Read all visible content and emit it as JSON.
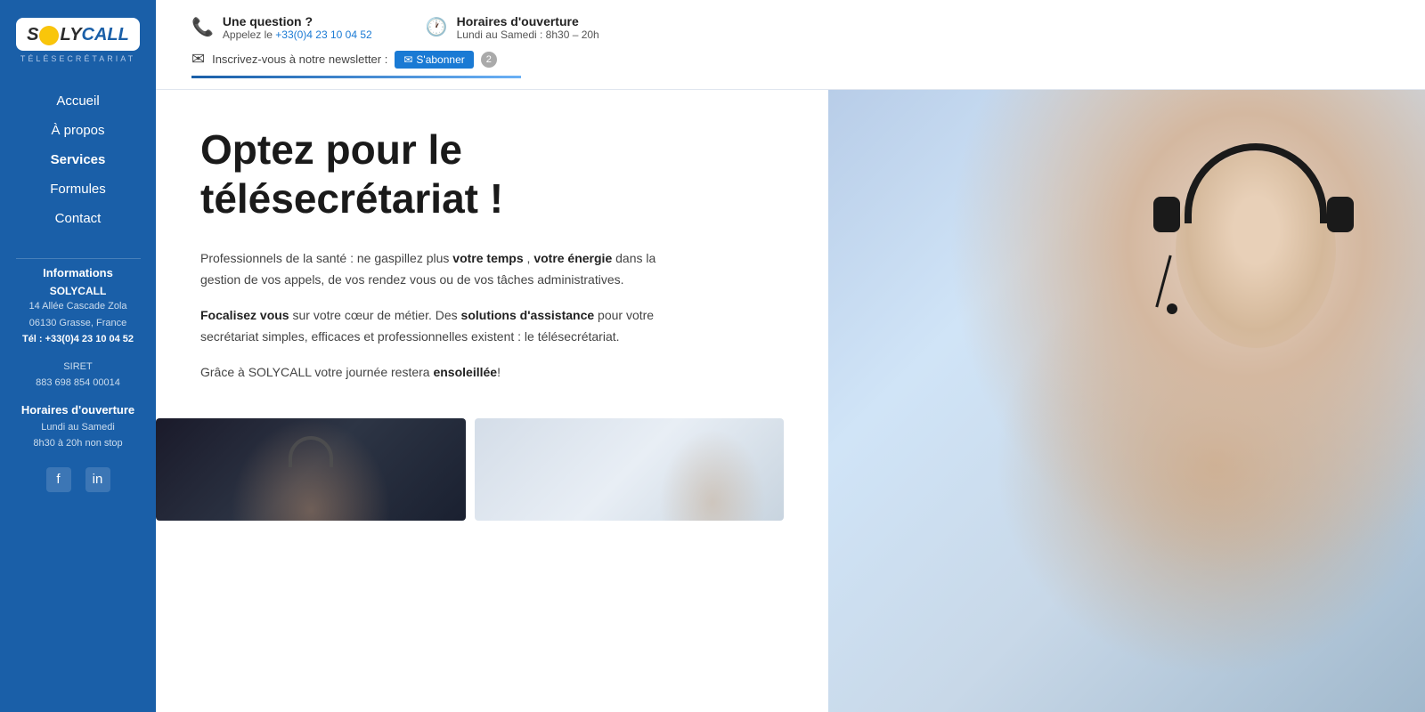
{
  "sidebar": {
    "logo_sol": "S",
    "logo_call": "LYCALL",
    "logo_subtitle": "TÉLÉSECRÉTARIAT",
    "nav": {
      "accueil": "Accueil",
      "apropos": "À propos",
      "services": "Services",
      "formules": "Formules",
      "contact": "Contact"
    },
    "info_title": "Informations",
    "company_name": "SOLYCALL",
    "address_line1": "14 Allée Cascade Zola",
    "address_line2": "06130 Grasse, France",
    "tel_label": "Tél : +33(0)4 23 10 04 52",
    "siret_label": "SIRET",
    "siret_number": "883 698 854 00014",
    "hours_title": "Horaires d'ouverture",
    "hours_line1": "Lundi au Samedi",
    "hours_line2": "8h30 à 20h non stop",
    "social_facebook": "f",
    "social_linkedin": "in"
  },
  "topbar": {
    "question_label": "Une question ?",
    "question_sub_prefix": "Appelez le ",
    "phone_number": "+33(0)4 23 10 04 52",
    "hours_label": "Horaires d'ouverture",
    "hours_sub": "Lundi au Samedi : 8h30 – 20h",
    "newsletter_label": "Inscrivez-vous à notre newsletter :",
    "subscribe_btn": "S'abonner",
    "subscribe_badge": "2"
  },
  "hero": {
    "title_line1": "Optez pour le",
    "title_line2": "télésecrétariat !",
    "paragraph1_pre": "Professionnels de la santé : ne gaspillez plus ",
    "paragraph1_bold1": "votre temps",
    "paragraph1_mid": " , ",
    "paragraph1_bold2": "votre énergie",
    "paragraph1_post": " dans la gestion de vos appels, de vos rendez vous ou de vos tâches administratives.",
    "paragraph2_bold": "Focalisez vous",
    "paragraph2_post": " sur votre cœur de métier. Des ",
    "paragraph2_bold2": "solutions d'assistance",
    "paragraph2_end": " pour votre secrétariat simples, efficaces et professionnelles existent : le télésecrétariat.",
    "paragraph3_pre": "Grâce à SOLYCALL votre journée restera ",
    "paragraph3_bold": "ensoleillée",
    "paragraph3_end": "!"
  },
  "icons": {
    "phone": "📞",
    "clock": "🕐",
    "envelope": "✉"
  }
}
